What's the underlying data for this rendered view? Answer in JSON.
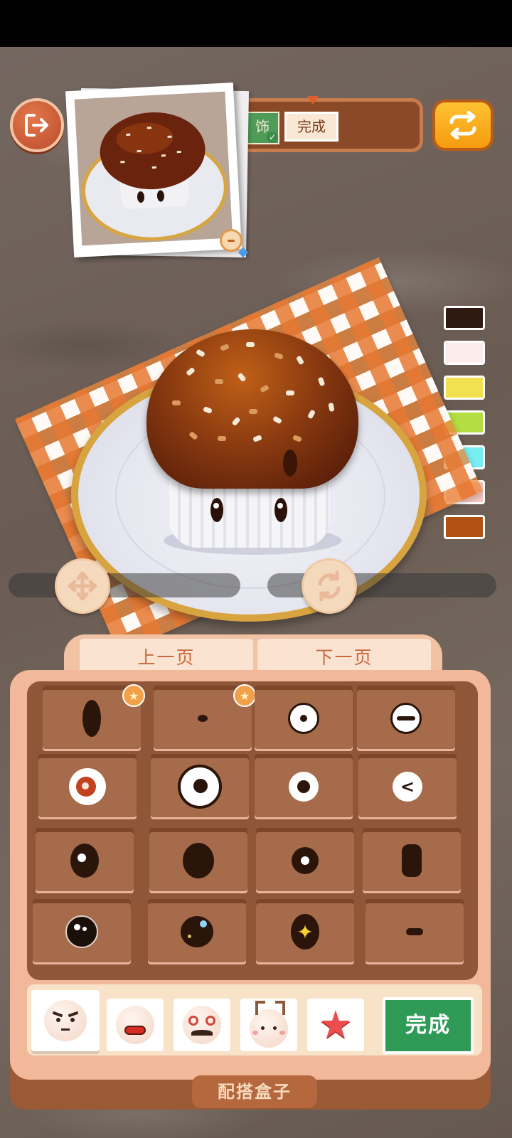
{
  "top_bar": {
    "step_decorate_label": "饰",
    "step_done_label": "完成"
  },
  "palette": {
    "colors": [
      "#2f1a12",
      "#fbeceb",
      "#f1e150",
      "#b3dd42",
      "#78eef2",
      "#f7c6c1",
      "#b15113"
    ]
  },
  "box": {
    "prev_page_label": "上一页",
    "next_page_label": "下一页",
    "done_label": "完成",
    "footer_label": "配搭盒子"
  },
  "tabs": {
    "items": [
      "angry-face-icon",
      "mouth-face-icon",
      "mustache-face-icon",
      "antler-face-icon",
      "star-sticker-icon"
    ],
    "selected": 0
  },
  "eye_items": [
    "tall-oval-eye-icon",
    "small-dot-eye-icon",
    "round-white-eye-icon",
    "closed-line-eye-icon",
    "red-iris-eye-icon",
    "big-white-eye-icon",
    "small-white-eye-icon",
    "wink-eye-icon",
    "dark-eye-highlight-icon",
    "plain-oval-eye-icon",
    "round-dark-eye-icon",
    "rounded-rect-eye-icon",
    "sparkle-dark-eye-icon",
    "blue-glint-eye-icon",
    "star-eye-icon",
    "dash-eye-icon"
  ],
  "premium_items": [
    0,
    1
  ]
}
